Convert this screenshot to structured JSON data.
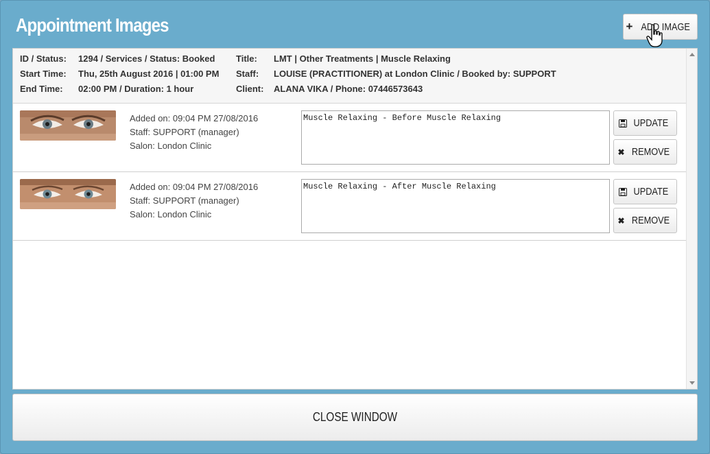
{
  "modal": {
    "title": "Appointment Images",
    "add_button_label": "ADD IMAGE",
    "close_button_label": "CLOSE WINDOW"
  },
  "appointment": {
    "id_status_label": "ID / Status:",
    "id_status_value": "1294 / Services / Status: Booked",
    "start_label": "Start Time:",
    "start_value": "Thu, 25th August 2016 | 01:00 PM",
    "end_label": "End Time:",
    "end_value": "02:00 PM / Duration: 1 hour",
    "title_label": "Title:",
    "title_value": "LMT | Other Treatments | Muscle Relaxing",
    "staff_label": "Staff:",
    "staff_value": "LOUISE (PRACTITIONER) at London Clinic / Booked by: SUPPORT",
    "client_label": "Client:",
    "client_value": "ALANA VIKA / Phone: 07446573643"
  },
  "images": [
    {
      "added": "Added on: 09:04 PM 27/08/2016",
      "staff": "Staff: SUPPORT (manager)",
      "salon": "Salon: London Clinic",
      "note": "Muscle Relaxing - Before Muscle Relaxing",
      "update_label": "UPDATE",
      "remove_label": "REMOVE"
    },
    {
      "added": "Added on: 09:04 PM 27/08/2016",
      "staff": "Staff: SUPPORT (manager)",
      "salon": "Salon: London Clinic",
      "note": "Muscle Relaxing - After Muscle Relaxing",
      "update_label": "UPDATE",
      "remove_label": "REMOVE"
    }
  ],
  "icons": {
    "add": "plus-icon",
    "update": "floppy-disk-icon",
    "remove": "close-icon",
    "cursor": "hand-pointer-icon"
  },
  "colors": {
    "modal_background": "#6aaccc",
    "title_text": "#ffffff",
    "panel_background": "#ffffff",
    "info_background": "#f6f6f6"
  }
}
